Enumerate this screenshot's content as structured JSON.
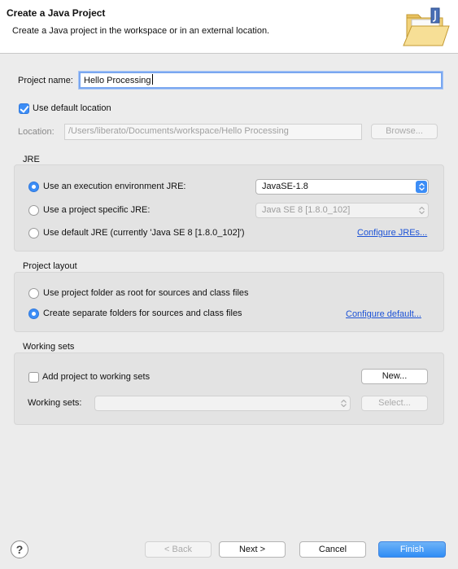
{
  "header": {
    "title": "Create a Java Project",
    "subtitle": "Create a Java project in the workspace or in an external location."
  },
  "project": {
    "name_label": "Project name:",
    "name_value": "Hello Processing",
    "use_default_location_label": "Use default location",
    "use_default_location_checked": true,
    "location_label": "Location:",
    "location_value": "/Users/liberato/Documents/workspace/Hello Processing",
    "browse_label": "Browse..."
  },
  "jre": {
    "section_title": "JRE",
    "exec_env_label": "Use an execution environment JRE:",
    "exec_env_value": "JavaSE-1.8",
    "project_specific_label": "Use a project specific JRE:",
    "project_specific_value": "Java SE 8 [1.8.0_102]",
    "default_label": "Use default JRE (currently 'Java SE 8 [1.8.0_102]')",
    "configure_link": "Configure JREs...",
    "selected": "exec_env"
  },
  "layout": {
    "section_title": "Project layout",
    "root_label": "Use project folder as root for sources and class files",
    "separate_label": "Create separate folders for sources and class files",
    "configure_link": "Configure default...",
    "selected": "separate"
  },
  "working_sets": {
    "section_title": "Working sets",
    "add_label": "Add project to working sets",
    "new_label": "New...",
    "sets_label": "Working sets:",
    "sets_value": "",
    "select_label": "Select..."
  },
  "footer": {
    "help_glyph": "?",
    "back_label": "< Back",
    "next_label": "Next >",
    "cancel_label": "Cancel",
    "finish_label": "Finish"
  },
  "colors": {
    "accent": "#3c8df6",
    "link": "#1d53d6",
    "window_bg": "#ececec"
  },
  "icons": {
    "header": "java-project-folder-icon",
    "help": "help-icon"
  }
}
